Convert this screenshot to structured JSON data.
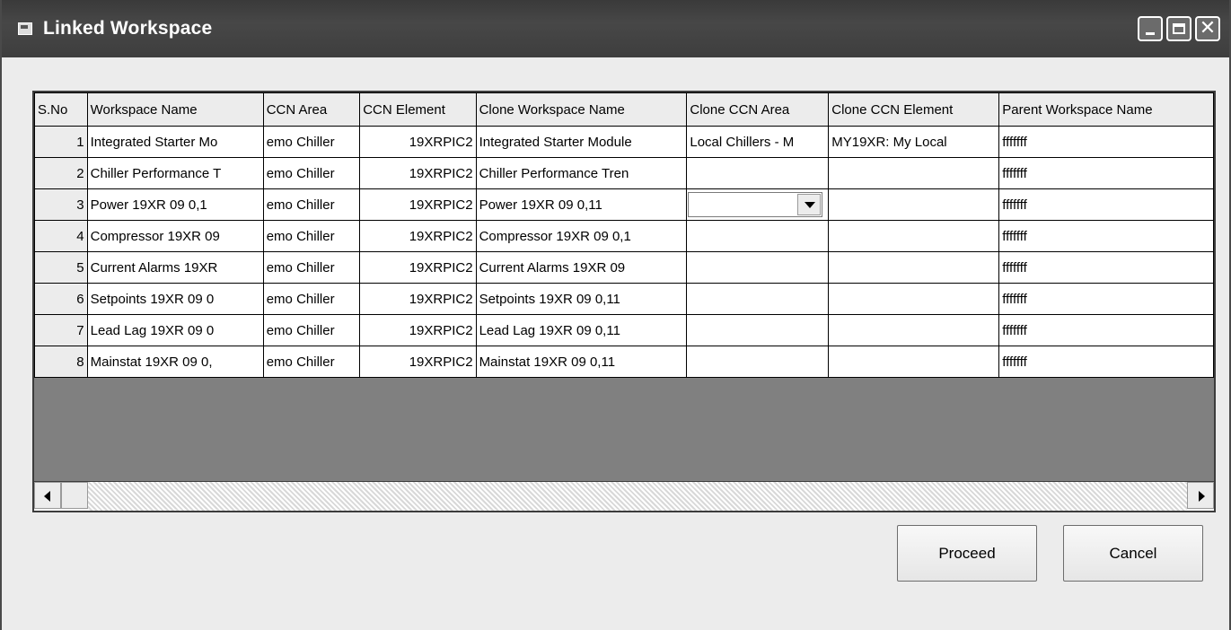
{
  "window": {
    "title": "Linked Workspace"
  },
  "grid": {
    "columns": [
      "S.No",
      "Workspace Name",
      "CCN Area",
      "CCN Element",
      "Clone Workspace Name",
      "Clone CCN Area",
      "Clone CCN Element",
      "Parent Workspace Name"
    ],
    "rows": [
      [
        "1",
        "Integrated Starter Mo",
        "emo Chiller",
        "19XRPIC2",
        "Integrated Starter Module",
        "Local Chillers - M",
        "MY19XR: My Local",
        "fffffff"
      ],
      [
        "2",
        "Chiller Performance T",
        "emo Chiller",
        "19XRPIC2",
        "Chiller Performance Tren",
        "",
        "",
        "fffffff"
      ],
      [
        "3",
        "Power 19XR 09 0,1",
        "emo Chiller",
        "19XRPIC2",
        "Power 19XR 09 0,11",
        "",
        "",
        "fffffff"
      ],
      [
        "4",
        "Compressor 19XR 09",
        "emo Chiller",
        "19XRPIC2",
        "Compressor 19XR 09 0,1",
        "",
        "",
        "fffffff"
      ],
      [
        "5",
        "Current Alarms 19XR",
        "emo Chiller",
        "19XRPIC2",
        "Current Alarms 19XR 09",
        "",
        "",
        "fffffff"
      ],
      [
        "6",
        "Setpoints 19XR 09 0",
        "emo Chiller",
        "19XRPIC2",
        "Setpoints 19XR 09 0,11",
        "",
        "",
        "fffffff"
      ],
      [
        "7",
        "Lead Lag 19XR 09 0",
        "emo Chiller",
        "19XRPIC2",
        "Lead Lag 19XR 09 0,11",
        "",
        "",
        "fffffff"
      ],
      [
        "8",
        "Mainstat 19XR 09 0,",
        "emo Chiller",
        "19XRPIC2",
        "Mainstat 19XR 09 0,11",
        "",
        "",
        "fffffff"
      ]
    ],
    "dropdown": {
      "value": ""
    }
  },
  "buttons": {
    "proceed": "Proceed",
    "cancel": "Cancel"
  },
  "icons": [
    "window-icon",
    "minimize-icon",
    "maximize-icon",
    "close-icon",
    "dropdown-arrow-icon",
    "scroll-left-icon",
    "scroll-right-icon"
  ],
  "colors": {
    "titlebar": "#3e3e3e",
    "window_bg": "#ececec",
    "grid_empty": "#808080"
  }
}
